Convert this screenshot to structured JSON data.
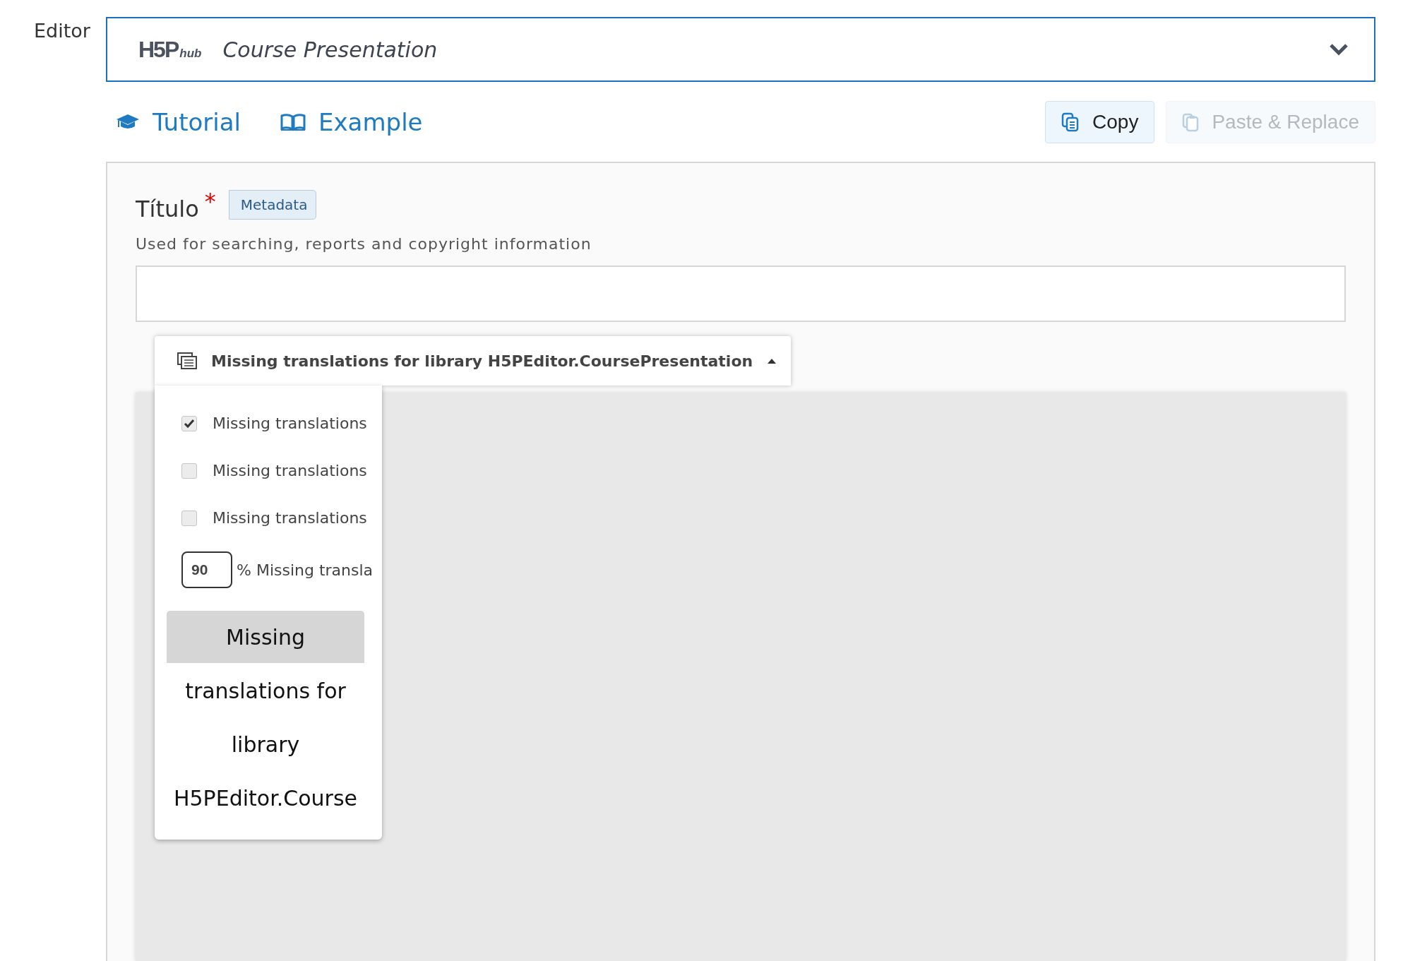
{
  "editor_label": "Editor",
  "hub": {
    "logo": "H5P",
    "logo_suffix": "hub",
    "title": "Course Presentation",
    "expanded": false
  },
  "links": [
    {
      "kind": "tutorial",
      "label": "Tutorial"
    },
    {
      "kind": "example",
      "label": "Example"
    }
  ],
  "buttons": [
    {
      "kind": "copy",
      "label": "Copy",
      "disabled": false
    },
    {
      "kind": "paste",
      "label": "Paste & Replace",
      "disabled": true
    }
  ],
  "field": {
    "label": "Título",
    "required": true,
    "required_mark": "*",
    "metadata": "Metadata",
    "description": "Used for searching, reports and copyright information"
  },
  "translation_menu": {
    "title": "Missing translations for library H5PEditor.CoursePresentation",
    "expanded": true,
    "options": [
      {
        "kind": "checkbox",
        "label": "Missing translations",
        "checked": true
      },
      {
        "kind": "checkbox",
        "label": "Missing translations",
        "checked": false
      },
      {
        "kind": "checkbox",
        "label": "Missing translations",
        "checked": false
      },
      {
        "kind": "number",
        "value": "90",
        "label": "% Missing transla"
      },
      {
        "kind": "button",
        "label": "Missing translations for library H5PEditor.Course"
      }
    ]
  }
}
